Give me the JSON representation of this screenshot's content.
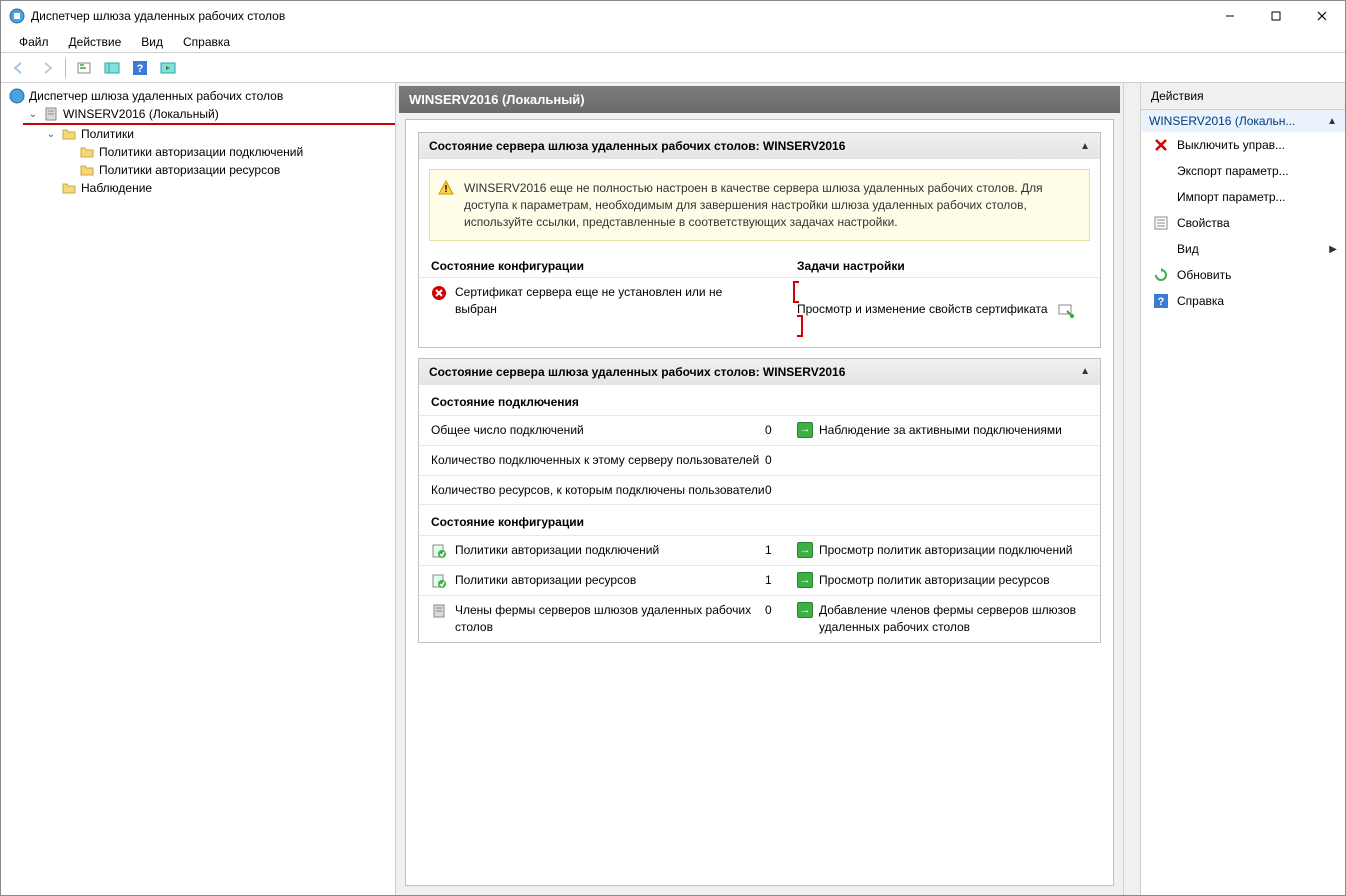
{
  "window": {
    "title": "Диспетчер шлюза удаленных рабочих столов"
  },
  "menu": {
    "file": "Файл",
    "action": "Действие",
    "view": "Вид",
    "help": "Справка"
  },
  "tree": {
    "root": "Диспетчер шлюза удаленных рабочих столов",
    "server": "WINSERV2016 (Локальный)",
    "policies": "Политики",
    "conn_auth_policies": "Политики авторизации подключений",
    "res_auth_policies": "Политики авторизации ресурсов",
    "monitoring": "Наблюдение"
  },
  "middle": {
    "header": "WINSERV2016 (Локальный)",
    "section1": {
      "title": "Состояние сервера шлюза удаленных рабочих столов: WINSERV2016",
      "warning": "WINSERV2016 еще не полностью настроен в качестве сервера шлюза удаленных рабочих столов. Для доступа к параметрам, необходимым для завершения настройки шлюза удаленных рабочих столов, используйте ссылки, представленные в соответствующих задачах настройки.",
      "col_config": "Состояние конфигурации",
      "col_tasks": "Задачи настройки",
      "cert_status": "Сертификат сервера еще не установлен или не выбран",
      "cert_task": "Просмотр и изменение свойств сертификата"
    },
    "section2": {
      "title": "Состояние сервера шлюза удаленных рабочих столов: WINSERV2016",
      "conn_state_header": "Состояние подключения",
      "rows_conn": [
        {
          "label": "Общее число подключений",
          "value": "0",
          "task": "Наблюдение за активными подключениями"
        },
        {
          "label": "Количество подключенных к этому серверу пользователей",
          "value": "0",
          "task": ""
        },
        {
          "label": "Количество ресурсов, к которым подключены пользователи",
          "value": "0",
          "task": ""
        }
      ],
      "config_state_header": "Состояние конфигурации",
      "rows_cfg": [
        {
          "label": "Политики авторизации подключений",
          "value": "1",
          "task": "Просмотр политик авторизации подключений"
        },
        {
          "label": "Политики авторизации ресурсов",
          "value": "1",
          "task": "Просмотр политик авторизации ресурсов"
        },
        {
          "label": "Члены фермы серверов шлюзов удаленных рабочих столов",
          "value": "0",
          "task": "Добавление членов фермы серверов шлюзов удаленных рабочих столов"
        }
      ]
    }
  },
  "actions": {
    "title": "Действия",
    "group": "WINSERV2016 (Локальн...",
    "items": {
      "disable": "Выключить управ...",
      "export": "Экспорт параметр...",
      "import": "Импорт параметр...",
      "properties": "Свойства",
      "view": "Вид",
      "refresh": "Обновить",
      "help": "Справка"
    }
  }
}
